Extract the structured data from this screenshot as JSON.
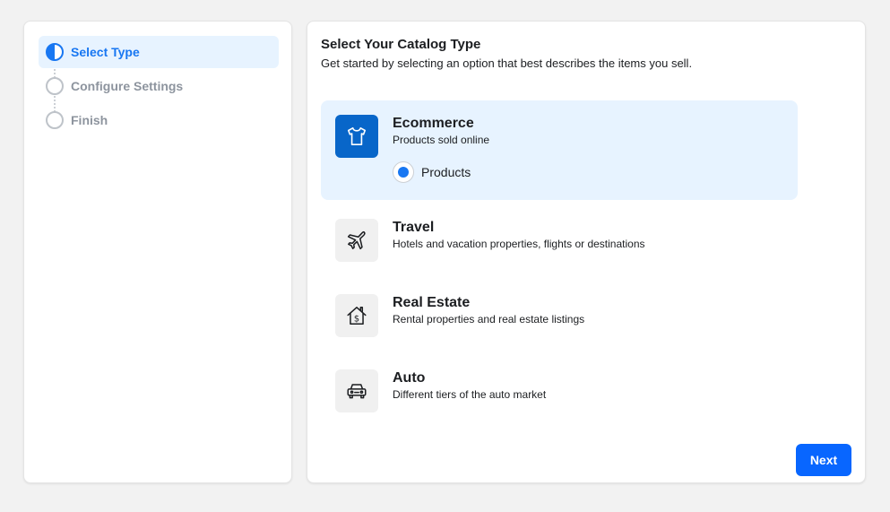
{
  "steps": [
    {
      "label": "Select Type",
      "state": "active"
    },
    {
      "label": "Configure Settings",
      "state": "pending"
    },
    {
      "label": "Finish",
      "state": "pending"
    }
  ],
  "main": {
    "title": "Select Your Catalog Type",
    "subtitle": "Get started by selecting an option that best describes the items you sell."
  },
  "options": [
    {
      "title": "Ecommerce",
      "description": "Products sold online",
      "icon": "tshirt-icon",
      "selected": true,
      "sub_option": {
        "label": "Products",
        "checked": true
      }
    },
    {
      "title": "Travel",
      "description": "Hotels and vacation properties, flights or destinations",
      "icon": "airplane-icon",
      "selected": false
    },
    {
      "title": "Real Estate",
      "description": "Rental properties and real estate listings",
      "icon": "house-dollar-icon",
      "selected": false
    },
    {
      "title": "Auto",
      "description": "Different tiers of the auto market",
      "icon": "car-icon",
      "selected": false
    }
  ],
  "footer": {
    "next_label": "Next"
  },
  "colors": {
    "accent": "#1877f2",
    "selected_bg": "#e7f3ff",
    "button": "#0866ff",
    "page_bg": "#f2f2f2"
  }
}
